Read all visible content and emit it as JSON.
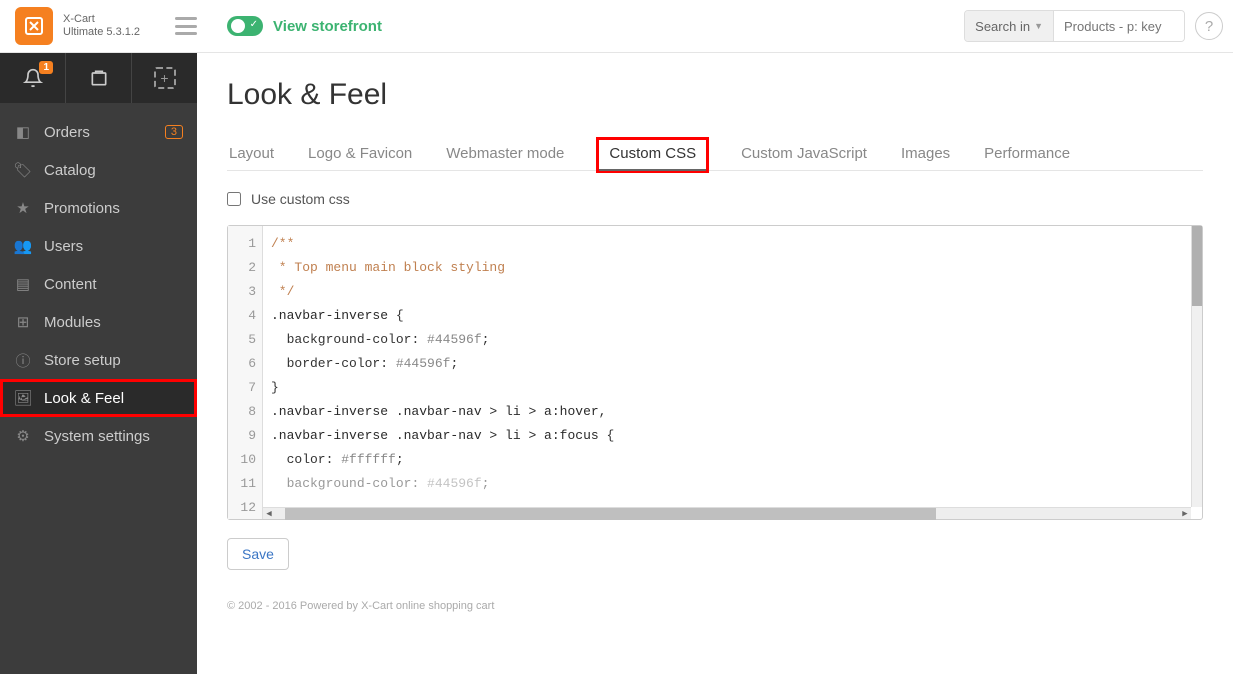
{
  "brand": {
    "name": "X-Cart",
    "edition": "Ultimate 5.3.1.2"
  },
  "topbar": {
    "storefront_label": "View storefront",
    "search_in_label": "Search in",
    "search_placeholder": "Products - p: key",
    "notif_count": "1"
  },
  "sidebar": {
    "items": [
      {
        "label": "Orders",
        "badge": "3"
      },
      {
        "label": "Catalog"
      },
      {
        "label": "Promotions"
      },
      {
        "label": "Users"
      },
      {
        "label": "Content"
      },
      {
        "label": "Modules"
      },
      {
        "label": "Store setup"
      },
      {
        "label": "Look & Feel"
      },
      {
        "label": "System settings"
      }
    ]
  },
  "page": {
    "title": "Look & Feel",
    "tabs": [
      {
        "label": "Layout"
      },
      {
        "label": "Logo & Favicon"
      },
      {
        "label": "Webmaster mode"
      },
      {
        "label": "Custom CSS"
      },
      {
        "label": "Custom JavaScript"
      },
      {
        "label": "Images"
      },
      {
        "label": "Performance"
      }
    ],
    "checkbox_label": "Use custom css",
    "save_label": "Save",
    "footer": "© 2002 - 2016 Powered by X-Cart online shopping cart"
  },
  "code": {
    "lines": [
      "1",
      "2",
      "3",
      "4",
      "5",
      "6",
      "7",
      "8",
      "9",
      "10",
      "11",
      "12"
    ],
    "l1": "/**",
    "l2": " * Top menu main block styling",
    "l3": " */",
    "l4_sel": ".navbar-inverse ",
    "l4_brace": "{",
    "l5_prop": "  background-color",
    "l5_colon": ": ",
    "l5_val": "#44596f",
    "l5_semi": ";",
    "l6_prop": "  border-color",
    "l6_colon": ": ",
    "l6_val": "#44596f",
    "l6_semi": ";",
    "l7": "}",
    "l8": "",
    "l9_sel": ".navbar-inverse .navbar-nav > li > a",
    "l9_pseudo": ":hover",
    "l9_comma": ",",
    "l10_sel": ".navbar-inverse .navbar-nav > li > a",
    "l10_pseudo": ":focus",
    "l10_brace": " {",
    "l11_prop": "  color",
    "l11_colon": ": ",
    "l11_val": "#ffffff",
    "l11_semi": ";",
    "l12_prop": "  background-color",
    "l12_colon": ": ",
    "l12_val": "#44596f",
    "l12_semi": ";"
  }
}
